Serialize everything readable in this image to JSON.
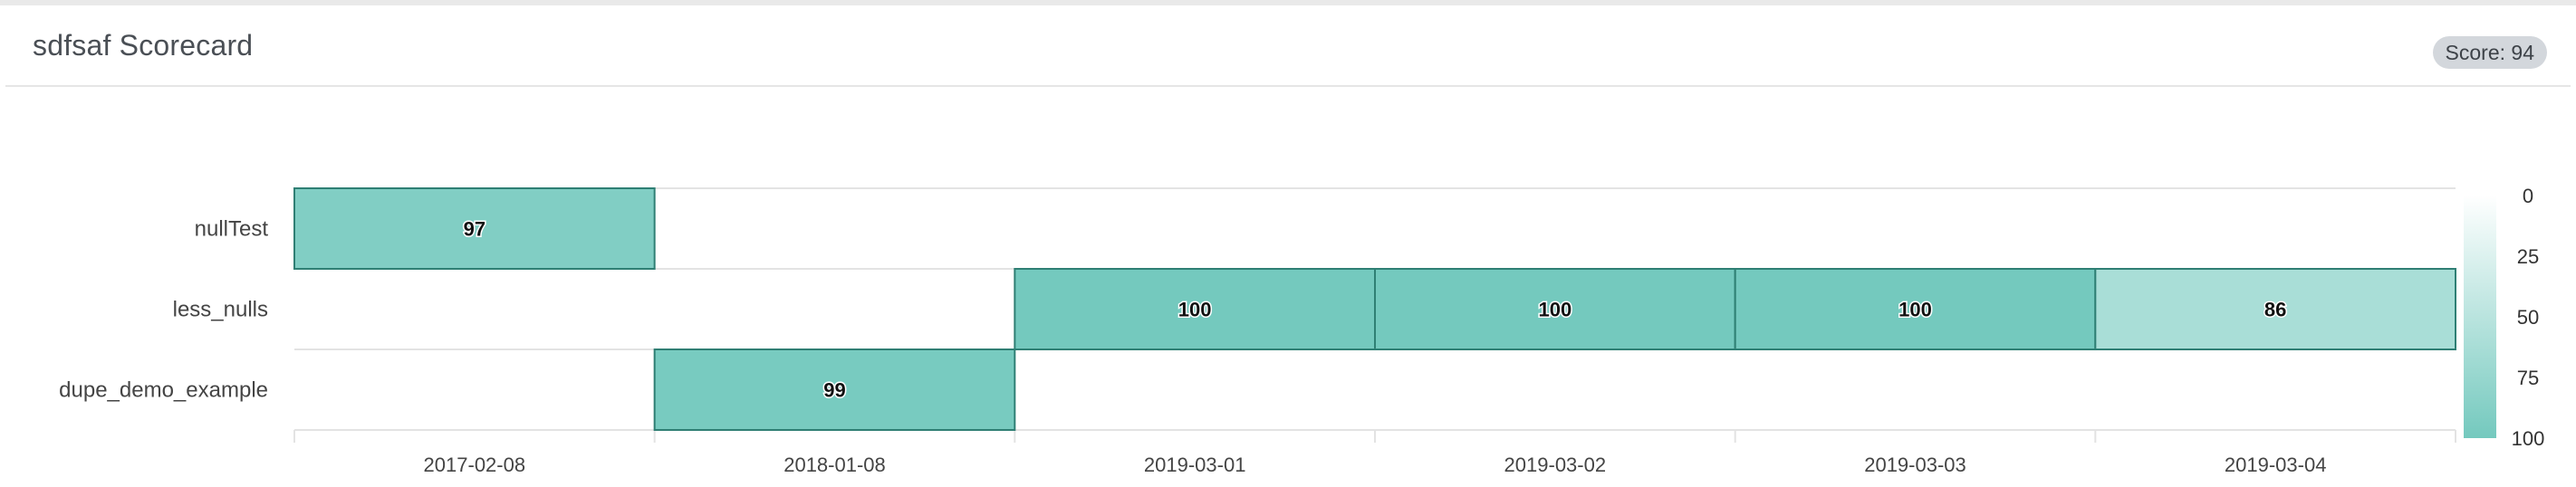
{
  "header": {
    "title": "sdfsaf Scorecard",
    "score_prefix": "Score: ",
    "score_value": "94"
  },
  "colors": {
    "cell_high": "#74c9be",
    "cell_low": "#ffffff",
    "cell_border": "#2f7f74",
    "grid": "#e3e3e3"
  },
  "chart_data": {
    "type": "heatmap",
    "title": "",
    "xlabel": "",
    "ylabel": "",
    "x": [
      "2017-02-08",
      "2018-01-08",
      "2019-03-01",
      "2019-03-02",
      "2019-03-03",
      "2019-03-04"
    ],
    "y": [
      "nullTest",
      "less_nulls",
      "dupe_demo_example"
    ],
    "cells": [
      {
        "x": "2017-02-08",
        "y": "nullTest",
        "value": 97
      },
      {
        "x": "2019-03-01",
        "y": "less_nulls",
        "value": 100
      },
      {
        "x": "2019-03-02",
        "y": "less_nulls",
        "value": 100
      },
      {
        "x": "2019-03-03",
        "y": "less_nulls",
        "value": 100
      },
      {
        "x": "2019-03-04",
        "y": "less_nulls",
        "value": 86
      },
      {
        "x": "2018-01-08",
        "y": "dupe_demo_example",
        "value": 99
      }
    ],
    "colorscale": {
      "range": [
        0,
        100
      ],
      "ticks": [
        "0",
        "25",
        "50",
        "75",
        "100"
      ]
    },
    "legend": "right",
    "grid": true
  }
}
